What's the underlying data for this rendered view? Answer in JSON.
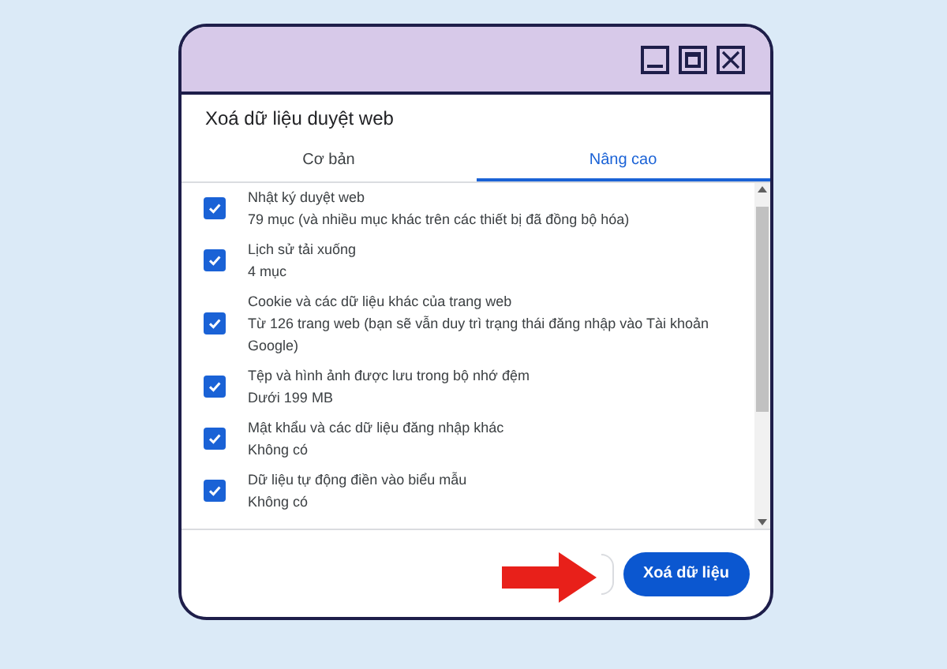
{
  "window": {
    "title": "Xoá dữ liệu duyệt web"
  },
  "tabs": [
    {
      "label": "Cơ bản",
      "selected": false
    },
    {
      "label": "Nâng cao",
      "selected": true
    }
  ],
  "items": [
    {
      "label": "Nhật ký duyệt web",
      "detail": "79 mục (và nhiều mục khác trên các thiết bị đã đồng bộ hóa)",
      "checked": true
    },
    {
      "label": "Lịch sử tải xuống",
      "detail": "4 mục",
      "checked": true
    },
    {
      "label": "Cookie và các dữ liệu khác của trang web",
      "detail": "Từ 126 trang web (bạn sẽ vẫn duy trì trạng thái đăng nhập vào Tài khoản Google)",
      "checked": true
    },
    {
      "label": "Tệp và hình ảnh được lưu trong bộ nhớ đệm",
      "detail": "Dưới 199 MB",
      "checked": true
    },
    {
      "label": "Mật khẩu và các dữ liệu đăng nhập khác",
      "detail": "Không có",
      "checked": true
    },
    {
      "label": "Dữ liệu tự động điền vào biểu mẫu",
      "detail": "Không có",
      "checked": true
    }
  ],
  "buttons": {
    "confirm": "Xoá dữ liệu"
  }
}
